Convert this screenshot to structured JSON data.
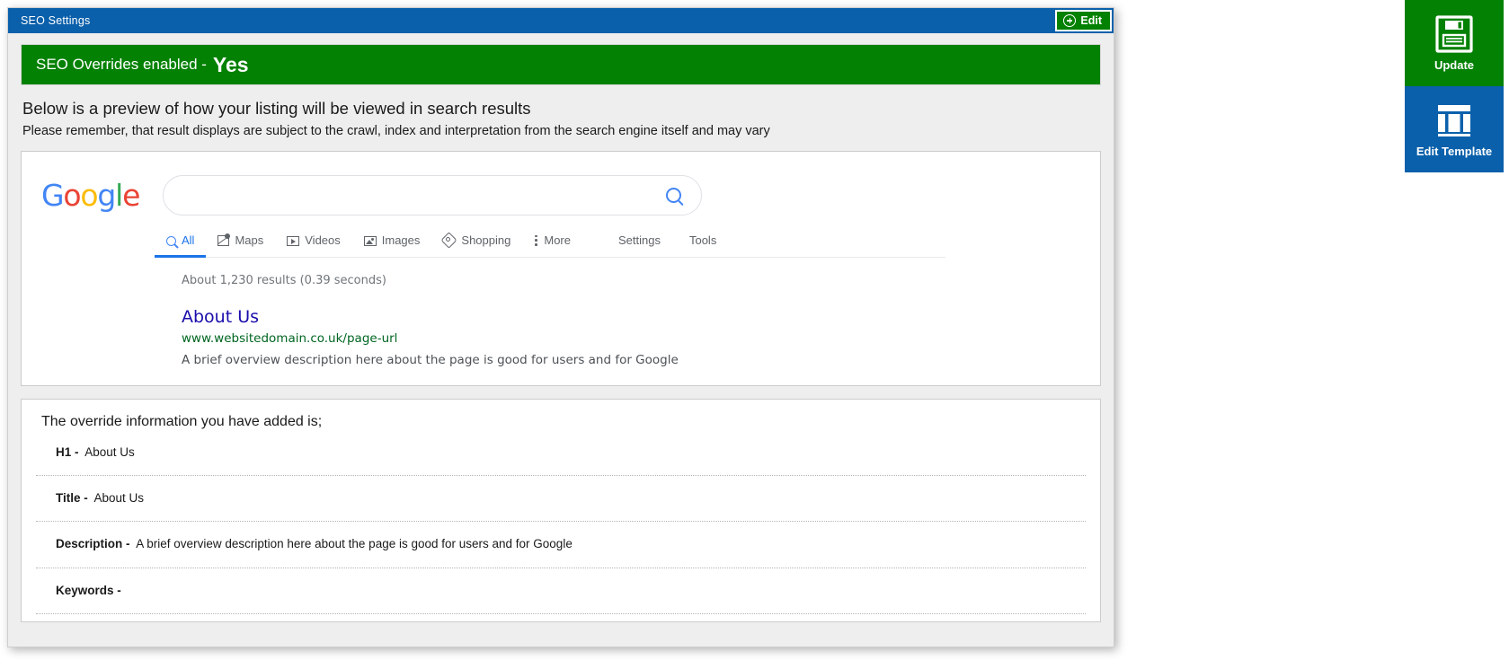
{
  "window": {
    "title": "SEO Settings",
    "edit_button": {
      "label": "Edit",
      "icon": "plus-circle-icon"
    }
  },
  "banner": {
    "label": "SEO Overrides enabled -",
    "value": "Yes",
    "color": "#038103"
  },
  "intro": {
    "line1": "Below is a preview of how your listing will be viewed in search results",
    "line2": "Please remember, that result displays are subject to the crawl, index and interpretation from the search engine itself and may vary"
  },
  "google_preview": {
    "logo": {
      "g1": "G",
      "o1": "o",
      "o2": "o",
      "g2": "g",
      "l": "l",
      "e": "e"
    },
    "search_input": {
      "value": "",
      "placeholder": ""
    },
    "search_icon": "magnifier-icon",
    "tabs": [
      {
        "label": "All",
        "icon": "search-icon",
        "active": true
      },
      {
        "label": "Maps",
        "icon": "maps-icon",
        "active": false
      },
      {
        "label": "Videos",
        "icon": "videos-icon",
        "active": false
      },
      {
        "label": "Images",
        "icon": "images-icon",
        "active": false
      },
      {
        "label": "Shopping",
        "icon": "shopping-tag-icon",
        "active": false
      },
      {
        "label": "More",
        "icon": "more-vertical-icon",
        "active": false
      }
    ],
    "right_links": [
      {
        "label": "Settings"
      },
      {
        "label": "Tools"
      }
    ],
    "result_stats": "About 1,230 results (0.39 seconds)",
    "result": {
      "title": "About Us",
      "url": "www.websitedomain.co.uk/page-url",
      "description": "A brief overview description here about the page is good for users and for Google",
      "title_color": "#1a0dab",
      "url_color": "#006621"
    }
  },
  "overrides": {
    "heading": "The override information you have added is;",
    "rows": [
      {
        "label": "H1 -",
        "value": "About Us"
      },
      {
        "label": "Title -",
        "value": "About Us"
      },
      {
        "label": "Description -",
        "value": "A brief overview description here about the page is good for users and for Google"
      },
      {
        "label": "Keywords -",
        "value": ""
      }
    ]
  },
  "side_buttons": [
    {
      "label": "Update",
      "icon": "save-floppy-icon",
      "color": "#038103"
    },
    {
      "label": "Edit Template",
      "icon": "layout-columns-icon",
      "color": "#0a60ab"
    }
  ]
}
